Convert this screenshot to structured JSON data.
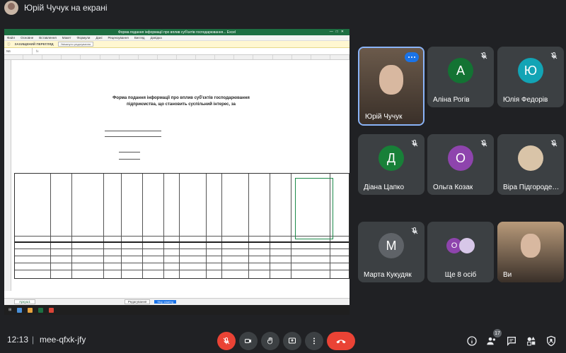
{
  "presenter": {
    "label": "Юрій Чучук на екрані"
  },
  "shared_screen": {
    "window_title": "Форма подання інформації про вплив суб'єктів господарювання... Excel",
    "menu": [
      "Файл",
      "Основне",
      "Вставлення",
      "Макет",
      "Формули",
      "Дані",
      "Рецензування",
      "Вигляд",
      "Довідка"
    ],
    "ribbon_notice": "ЗАХИЩЕНИЙ ПЕРЕГЛЯД",
    "ribbon_button": "Увімкнути редагування",
    "cell_ref": "N6",
    "sheet_title_1": "Форма подання інформації про вплив суб'єктів господарювання",
    "sheet_title_2": "підприємства, що становить суспільний інтерес, за",
    "sheet_tab": "Аркуш1",
    "status_message": "Редагування",
    "blue_button": "Stop sharing"
  },
  "participants": [
    {
      "name": "Юрій Чучук",
      "initial": "",
      "color": "#6b5a4b",
      "video": true,
      "muted": false
    },
    {
      "name": "Аліна Рогів",
      "initial": "А",
      "color": "#137333"
    },
    {
      "name": "Юлія Федорів",
      "initial": "Ю",
      "color": "#12a4b5"
    },
    {
      "name": "Діана Цапко",
      "initial": "Д",
      "color": "#188038"
    },
    {
      "name": "Ольга Козак",
      "initial": "О",
      "color": "#8e44ad"
    },
    {
      "name": "Віра Підгородецька",
      "initial": "",
      "color": "#d9c4a8"
    },
    {
      "name": "Марта Кукудяк",
      "initial": "М",
      "color": "#5f6368"
    },
    {
      "name": "Ще 8 осіб",
      "initial": "О",
      "color": "#8e44ad"
    },
    {
      "name": "Ви",
      "initial": "",
      "color": "#b89a7a",
      "video": true
    }
  ],
  "bottombar": {
    "time": "12:13",
    "separator": "|",
    "meeting_code": "mee-qfxk-jfy",
    "people_count": "17"
  },
  "colors": {
    "background": "#202124",
    "tile": "#3c4043",
    "end_call": "#ea4335",
    "accent": "#8ab4f8"
  }
}
